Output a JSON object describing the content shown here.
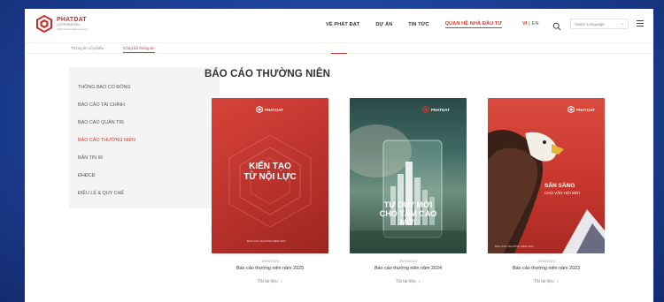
{
  "brand": {
    "name": "PHATDAT",
    "sub": "CORPORATION",
    "tagline": "Think Great Achievements"
  },
  "nav": {
    "items": [
      {
        "label": "VỀ PHÁT ĐẠT",
        "active": false
      },
      {
        "label": "DỰ ÁN",
        "active": false
      },
      {
        "label": "TIN TỨC",
        "active": false
      },
      {
        "label": "QUAN HỆ NHÀ ĐẦU TƯ",
        "active": true
      }
    ],
    "lang_vi": "VI",
    "lang_sep": "|",
    "lang_en": "EN",
    "select_language": "Select Language"
  },
  "subtabs": [
    {
      "label": "Thông tin cổ phiếu",
      "active": false
    },
    {
      "label": "Công bố thông tin",
      "active": true
    }
  ],
  "sidebar": {
    "items": [
      {
        "label": "THÔNG BÁO CỔ ĐÔNG",
        "active": false
      },
      {
        "label": "BÁO CÁO TÀI CHÍNH",
        "active": false
      },
      {
        "label": "BÁO CÁO QUẢN TRỊ",
        "active": false
      },
      {
        "label": "BÁO CÁO THƯỜNG NIÊN",
        "active": true
      },
      {
        "label": "BẢN TIN IR",
        "active": false
      },
      {
        "label": "ĐHĐCĐ",
        "active": false
      },
      {
        "label": "ĐIỀU LỆ & QUY CHẾ",
        "active": false
      }
    ]
  },
  "main": {
    "title": "BÁO CÁO THƯỜNG NIÊN",
    "cards": [
      {
        "date": "15/04/2025",
        "title": "Báo cáo thường niên năm 2025",
        "download": "Tải tài liệu",
        "cover_lines": [
          "KIẾN TẠO",
          "TỪ NỘI LỰC"
        ],
        "cover_footer": "BÁO CÁO THƯỜNG NIÊN 2024"
      },
      {
        "date": "26/04/2024",
        "title": "Báo cáo thường niên năm 2024",
        "download": "Tải tài liệu",
        "cover_lines": [
          "TƯ DUY MỚI",
          "CHO TẦM CAO",
          "MỚI"
        ],
        "cover_footer": ""
      },
      {
        "date": "22/05/2023",
        "title": "Báo cáo thường niên năm 2023",
        "download": "Tải tài liệu",
        "cover_lines": [
          "SẴN SÀNG",
          "CHO VẬN HỘI MỚI"
        ],
        "cover_footer": "BÁO CÁO THƯỜNG NIÊN 2022"
      }
    ]
  },
  "colors": {
    "accent": "#d13a2f",
    "bg_blue": "#1c3f95"
  }
}
